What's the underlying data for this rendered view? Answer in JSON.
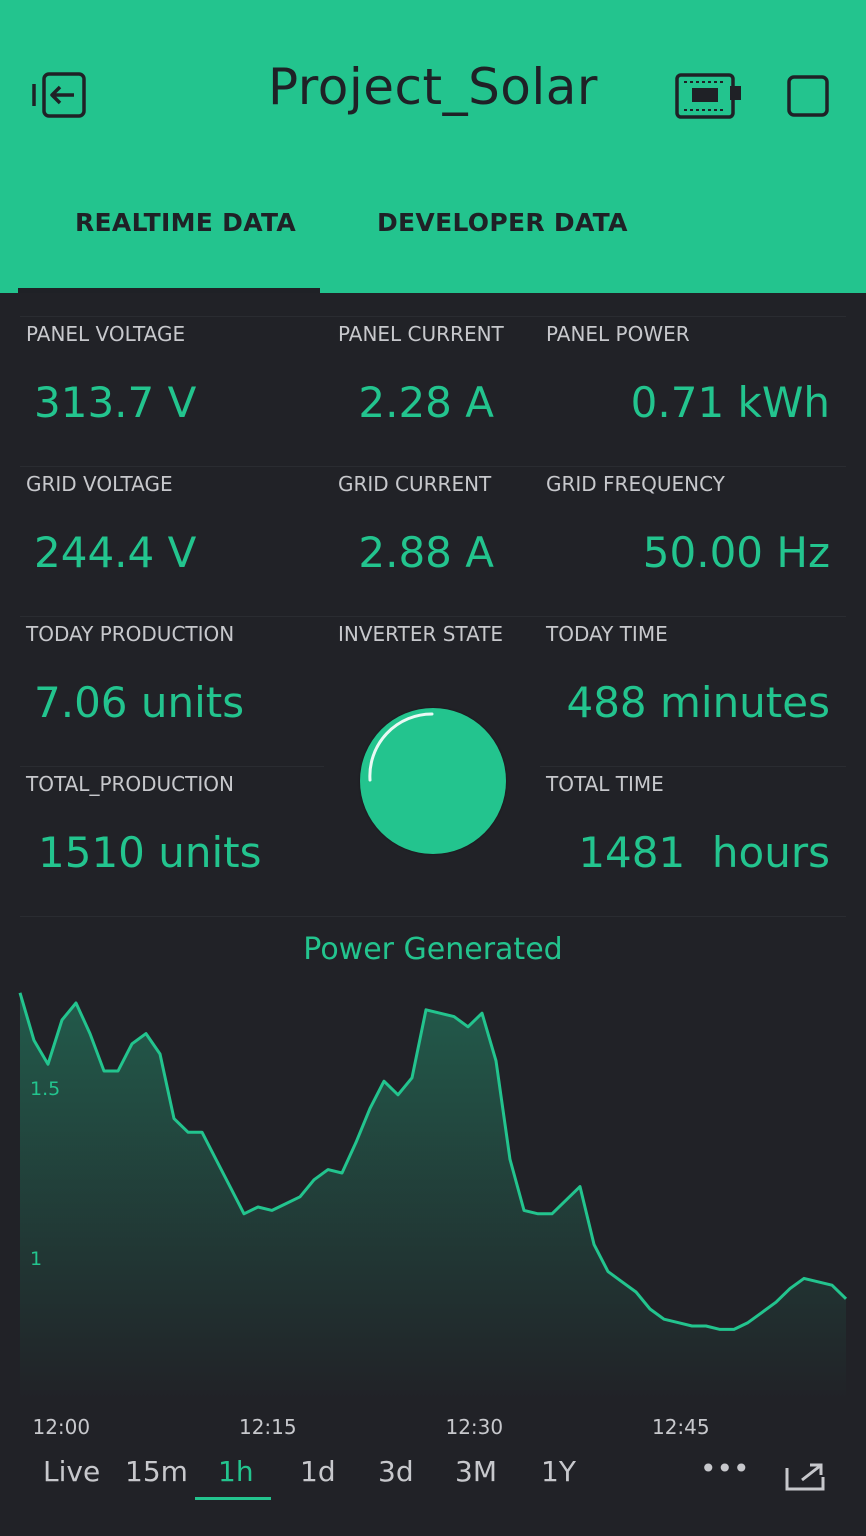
{
  "header": {
    "title": "Project_Solar",
    "tabs": [
      {
        "label": "REALTIME DATA",
        "active": true
      },
      {
        "label": "DEVELOPER DATA",
        "active": false
      }
    ]
  },
  "metrics": {
    "panel_voltage": {
      "label": "PANEL VOLTAGE",
      "value": "313.7 V"
    },
    "panel_current": {
      "label": "PANEL CURRENT",
      "value": "2.28 A"
    },
    "panel_power": {
      "label": "PANEL POWER",
      "value": "0.71 kWh"
    },
    "grid_voltage": {
      "label": "GRID VOLTAGE",
      "value": "244.4 V"
    },
    "grid_current": {
      "label": "GRID CURRENT",
      "value": "2.88 A"
    },
    "grid_frequency": {
      "label": "GRID FREQUENCY",
      "value": "50.00 Hz"
    },
    "today_production": {
      "label": "TODAY PRODUCTION",
      "value": "7.06 units"
    },
    "inverter_state": {
      "label": "INVERTER STATE"
    },
    "today_time": {
      "label": "TODAY TIME",
      "value": "488 minutes"
    },
    "total_production": {
      "label": "TOTAL_PRODUCTION",
      "value": "1510 units"
    },
    "total_time": {
      "label": "TOTAL TIME",
      "value": "1481  hours"
    }
  },
  "colors": {
    "accent": "#23c48e",
    "background": "#212227",
    "header_text": "#1f2126",
    "label": "#c7c8cc"
  },
  "chart_data": {
    "type": "area",
    "title": "Power Generated",
    "xlabel": "",
    "ylabel": "",
    "x_ticks": [
      "12:00",
      "12:15",
      "12:30",
      "12:45"
    ],
    "y_ticks": [
      1,
      1.5
    ],
    "grid": false,
    "x": [
      "11:57",
      "11:58",
      "11:59",
      "12:00",
      "12:01",
      "12:02",
      "12:03",
      "12:04",
      "12:05",
      "12:06",
      "12:07",
      "12:08",
      "12:09",
      "12:10",
      "12:11",
      "12:12",
      "12:13",
      "12:14",
      "12:15",
      "12:16",
      "12:17",
      "12:18",
      "12:19",
      "12:20",
      "12:21",
      "12:22",
      "12:23",
      "12:24",
      "12:25",
      "12:26",
      "12:27",
      "12:28",
      "12:29",
      "12:30",
      "12:31",
      "12:32",
      "12:33",
      "12:34",
      "12:35",
      "12:36",
      "12:37",
      "12:38",
      "12:39",
      "12:40",
      "12:41",
      "12:42",
      "12:43",
      "12:44",
      "12:45",
      "12:46",
      "12:47",
      "12:48",
      "12:49",
      "12:50",
      "12:51",
      "12:52",
      "12:53",
      "12:54",
      "12:55",
      "12:56",
      "12:57"
    ],
    "series": [
      {
        "values": [
          1.78,
          1.64,
          1.57,
          1.7,
          1.75,
          1.66,
          1.55,
          1.55,
          1.63,
          1.66,
          1.6,
          1.41,
          1.37,
          1.37,
          1.29,
          1.21,
          1.13,
          1.15,
          1.14,
          1.16,
          1.18,
          1.23,
          1.26,
          1.25,
          1.34,
          1.44,
          1.52,
          1.48,
          1.53,
          1.73,
          1.72,
          1.71,
          1.68,
          1.72,
          1.58,
          1.29,
          1.14,
          1.13,
          1.13,
          1.17,
          1.21,
          1.04,
          0.96,
          0.93,
          0.9,
          0.85,
          0.82,
          0.81,
          0.8,
          0.8,
          0.79,
          0.79,
          0.81,
          0.84,
          0.87,
          0.91,
          0.94,
          0.93,
          0.92,
          0.88
        ]
      }
    ],
    "ylim": [
      0.5,
      1.85
    ]
  },
  "time_ranges": {
    "items": [
      "Live",
      "15m",
      "1h",
      "1d",
      "3d",
      "3M",
      "1Y"
    ],
    "selected": "1h",
    "more": "•••"
  }
}
